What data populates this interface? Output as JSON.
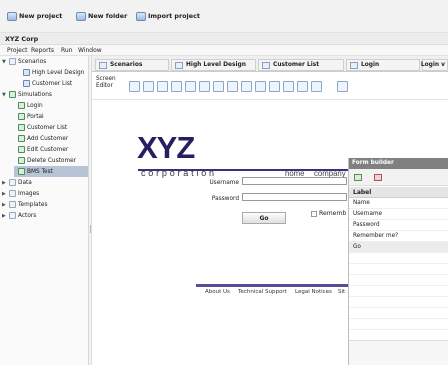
{
  "toolbar": {
    "items": [
      {
        "label": "New project",
        "icon": "new-project-icon"
      },
      {
        "label": "New folder",
        "icon": "new-folder-icon"
      },
      {
        "label": "Import project",
        "icon": "import-project-icon"
      }
    ]
  },
  "app": {
    "title": "XYZ Corp"
  },
  "menu": {
    "items": [
      "Project",
      "Reports",
      "Run",
      "Window"
    ]
  },
  "sidebar": {
    "items": [
      {
        "label": "Scenarios",
        "icon": "folder-icon"
      },
      {
        "label": "High Level Design",
        "icon": "page-icon"
      },
      {
        "label": "Customer List",
        "icon": "page-icon"
      },
      {
        "label": "Simulations",
        "icon": "folder-icon"
      },
      {
        "label": "Login",
        "icon": "green-page-icon"
      },
      {
        "label": "Portal",
        "icon": "green-page-icon"
      },
      {
        "label": "Customer List",
        "icon": "green-page-icon"
      },
      {
        "label": "Add Customer",
        "icon": "green-page-icon"
      },
      {
        "label": "Edit Customer",
        "icon": "green-page-icon"
      },
      {
        "label": "Delete Customer",
        "icon": "green-page-icon"
      },
      {
        "label": "BMS Test",
        "icon": "green-page-icon"
      },
      {
        "label": "Data",
        "icon": "folder-icon"
      },
      {
        "label": "Images",
        "icon": "folder-icon"
      },
      {
        "label": "Templates",
        "icon": "folder-icon"
      },
      {
        "label": "Actors",
        "icon": "folder-icon"
      }
    ]
  },
  "tabs": [
    {
      "label": "Scenarios"
    },
    {
      "label": "High Level Design"
    },
    {
      "label": "Customer List"
    },
    {
      "label": "Login"
    },
    {
      "label": "Login v"
    }
  ],
  "editor": {
    "screen_editor": "Screen Editor"
  },
  "page": {
    "logo": "XYZ",
    "corporation": "corporation",
    "nav": [
      "home",
      "company",
      "products",
      "news",
      "inves"
    ],
    "form": {
      "username_label": "Username",
      "password_label": "Password",
      "go_label": "Go",
      "remember_label": "Rememb"
    },
    "footer": [
      "About Us",
      "Technical Support",
      "Legal Notices",
      "Sit"
    ]
  },
  "form_builder": {
    "title": "Form builder",
    "header": "Label",
    "rows": [
      "Name",
      "Username",
      "Password",
      "Remember me?",
      "Go"
    ]
  },
  "colors": {
    "accent": "#3f2c83",
    "selection": "#b7c4d6",
    "panel_title": "#808080"
  }
}
